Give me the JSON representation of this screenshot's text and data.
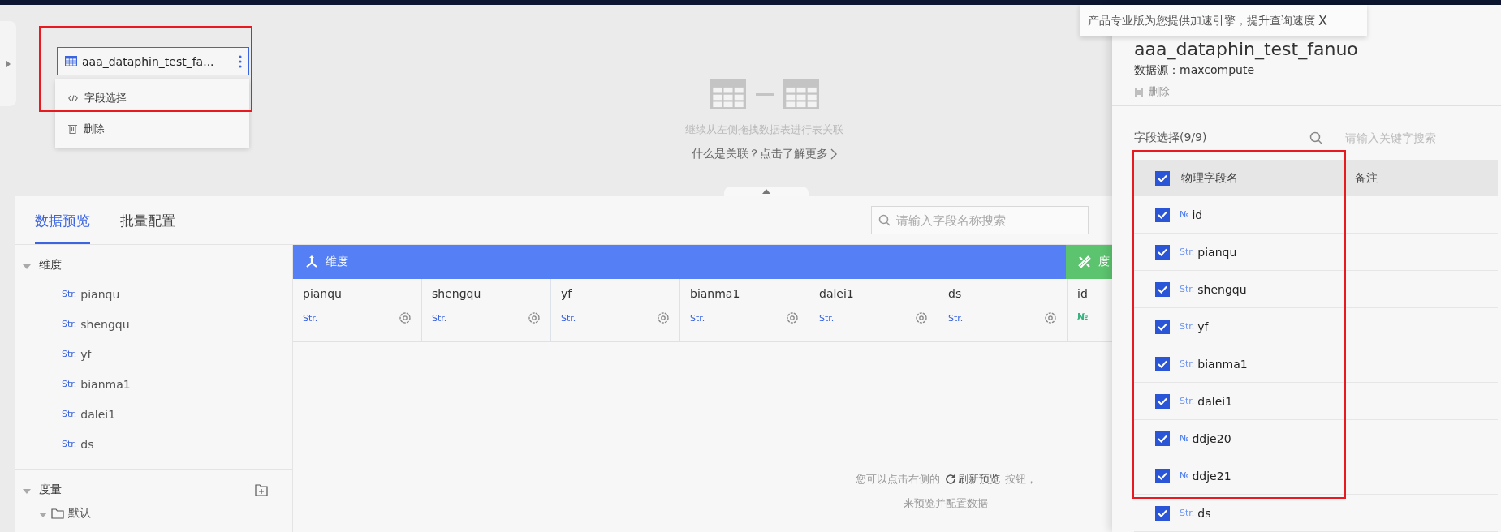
{
  "canvas": {
    "node": {
      "name": "aaa_dataphin_test_fa...",
      "menu": [
        {
          "kind": "fields",
          "label": "字段选择"
        },
        {
          "kind": "delete",
          "label": "删除"
        }
      ]
    },
    "empty_hint": "继续从左侧拖拽数据表进行表关联",
    "learn_more": "什么是关联？点击了解更多"
  },
  "tabs": [
    {
      "label": "数据预览",
      "selected": true
    },
    {
      "label": "批量配置",
      "selected": false
    }
  ],
  "field_search": {
    "placeholder": "请输入字段名称搜索"
  },
  "tree": [
    {
      "label": "维度",
      "expanded": true,
      "action": false,
      "children": [
        {
          "type": "Str.",
          "name": "pianqu"
        },
        {
          "type": "Str.",
          "name": "shengqu"
        },
        {
          "type": "Str.",
          "name": "yf"
        },
        {
          "type": "Str.",
          "name": "bianma1"
        },
        {
          "type": "Str.",
          "name": "dalei1"
        },
        {
          "type": "Str.",
          "name": "ds"
        }
      ]
    },
    {
      "label": "度量",
      "expanded": true,
      "action": true,
      "folders": [
        {
          "label": "默认",
          "expanded": true
        }
      ]
    }
  ],
  "grid": {
    "groups": [
      {
        "kind": "dimension",
        "label": "维度"
      },
      {
        "kind": "measure",
        "label": "度"
      }
    ],
    "columns": [
      {
        "name": "pianqu",
        "type": "Str.",
        "kind": "dimension"
      },
      {
        "name": "shengqu",
        "type": "Str.",
        "kind": "dimension"
      },
      {
        "name": "yf",
        "type": "Str.",
        "kind": "dimension"
      },
      {
        "name": "bianma1",
        "type": "Str.",
        "kind": "dimension"
      },
      {
        "name": "dalei1",
        "type": "Str.",
        "kind": "dimension"
      },
      {
        "name": "ds",
        "type": "Str.",
        "kind": "dimension"
      },
      {
        "name": "id",
        "type": "№",
        "kind": "measure"
      }
    ]
  },
  "preview_hint": {
    "before": "您可以点击右侧的",
    "link": "刷新预览",
    "after": "按钮，",
    "line2": "来预览并配置数据"
  },
  "banner": {
    "text": "产品专业版为您提供加速引擎，提升查询速度",
    "close": "X"
  },
  "panel": {
    "title": "aaa_dataphin_test_fanuo",
    "source": "数据源：maxcompute",
    "delete": "删除",
    "field_select": "字段选择(9/9)",
    "search_placeholder": "请输入关键字搜索",
    "header": {
      "checked": true,
      "name": "物理字段名",
      "note": "备注"
    },
    "fields": [
      {
        "type": "№",
        "name": "id",
        "checked": true
      },
      {
        "type": "Str.",
        "name": "pianqu",
        "checked": true
      },
      {
        "type": "Str.",
        "name": "shengqu",
        "checked": true
      },
      {
        "type": "Str.",
        "name": "yf",
        "checked": true
      },
      {
        "type": "Str.",
        "name": "bianma1",
        "checked": true
      },
      {
        "type": "Str.",
        "name": "dalei1",
        "checked": true
      },
      {
        "type": "№",
        "name": "ddje20",
        "checked": true
      },
      {
        "type": "№",
        "name": "ddje21",
        "checked": true
      },
      {
        "type": "Str.",
        "name": "ds",
        "checked": true
      }
    ]
  }
}
